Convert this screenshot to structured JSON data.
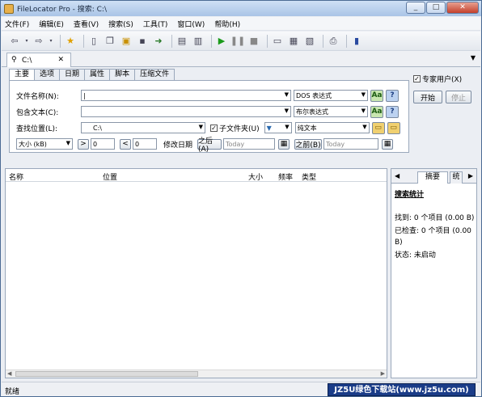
{
  "window": {
    "title": "FileLocator Pro - 搜索: C:\\"
  },
  "menu": [
    "文件(F)",
    "编辑(E)",
    "查看(V)",
    "搜索(S)",
    "工具(T)",
    "窗口(W)",
    "帮助(H)"
  ],
  "tab": {
    "label": "C:\\"
  },
  "subtabs": [
    "主要",
    "选项",
    "日期",
    "属性",
    "脚本",
    "压缩文件"
  ],
  "form": {
    "filename_label": "文件名称(N):",
    "filename_mode": "DOS 表达式",
    "content_label": "包含文本(C):",
    "content_mode": "布尔表达式",
    "location_label": "查找位置(L):",
    "location_value": "C:\\",
    "subfolders_label": "子文件夹(U)",
    "text_mode": "纯文本",
    "size_label": "大小 (kB)",
    "size_gt": ">",
    "size_gt_value": "0",
    "size_lt": "<",
    "size_lt_value": "0",
    "modified_label": "修改日期",
    "after_label": "之后(A)",
    "after_value": "Today",
    "before_label": "之前(B)",
    "before_value": "Today",
    "aa_label": "Aa",
    "help_label": "?"
  },
  "right": {
    "expert_label": "专家用户(X)",
    "start_label": "开始",
    "stop_label": "停止"
  },
  "results": {
    "columns": [
      "名称",
      "位置",
      "大小",
      "频率",
      "类型"
    ]
  },
  "stats": {
    "tab_active": "摘要",
    "tab_other": "统",
    "header": "搜索统计",
    "found": "找到: 0 个项目 (0.00 B)",
    "checked": "已检查: 0 个项目 (0.00 B)",
    "status": "状态: 未启动"
  },
  "statusbar": {
    "text": "就绪",
    "watermark": "JZ5U绿色下载站(www.jz5u.com)"
  }
}
